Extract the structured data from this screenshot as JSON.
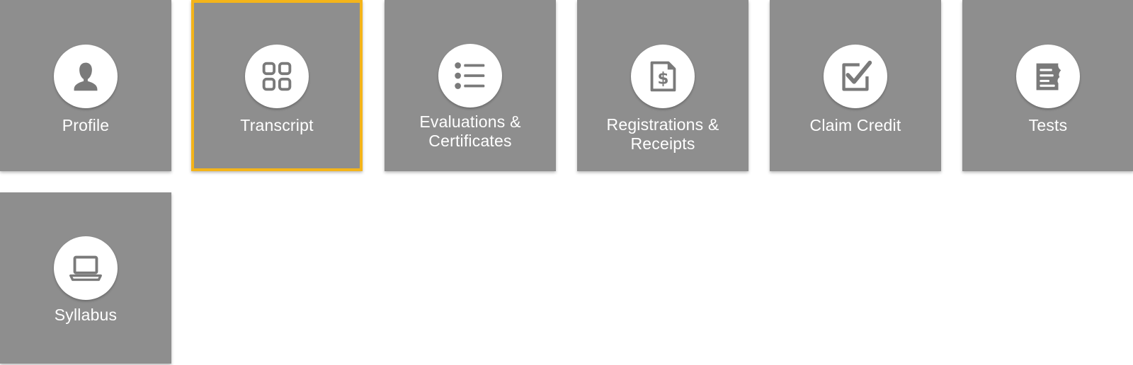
{
  "tiles": [
    {
      "label": "Profile",
      "icon": "person-icon"
    },
    {
      "label": "Transcript",
      "icon": "grid-icon",
      "selected": true
    },
    {
      "label": "Evaluations & Certificates",
      "icon": "list-icon"
    },
    {
      "label": "Registrations & Receipts",
      "icon": "dollar-document-icon"
    },
    {
      "label": "Claim Credit",
      "icon": "checkbox-icon"
    },
    {
      "label": "Tests",
      "icon": "test-paper-icon"
    },
    {
      "label": "Syllabus",
      "icon": "laptop-icon"
    }
  ],
  "colors": {
    "tile_bg": "#8e8e8e",
    "selected_border": "#f4b41a",
    "icon_fill": "#7a7a7a",
    "label": "#ffffff"
  }
}
